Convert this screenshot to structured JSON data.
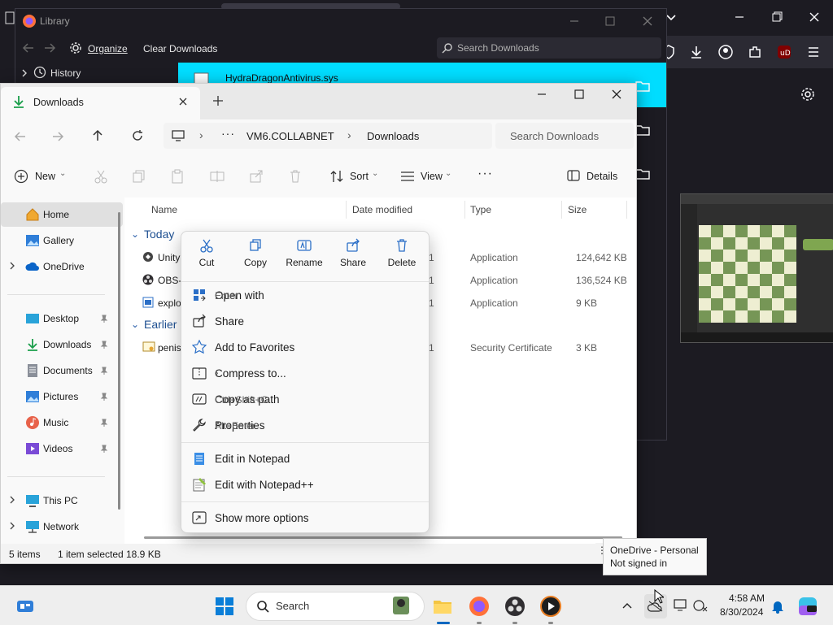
{
  "library": {
    "title": "Library",
    "organize_label": "Organize",
    "clear_label": "Clear Downloads",
    "search_placeholder": "Search Downloads",
    "history_label": "History",
    "file_name": "HydraDragonAntivirus.sys"
  },
  "explorer": {
    "tab_title": "Downloads",
    "breadcrumb": [
      "VM6.COLLABNET",
      "Downloads"
    ],
    "search_placeholder": "Search Downloads",
    "cmd": {
      "new": "New",
      "sort": "Sort",
      "view": "View",
      "details": "Details"
    },
    "sidebar": {
      "home": "Home",
      "gallery": "Gallery",
      "onedrive": "OneDrive",
      "desktop": "Desktop",
      "downloads": "Downloads",
      "documents": "Documents",
      "pictures": "Pictures",
      "music": "Music",
      "videos": "Videos",
      "thispc": "This PC",
      "network": "Network"
    },
    "columns": {
      "name": "Name",
      "date": "Date modified",
      "type": "Type",
      "size": "Size"
    },
    "groups": {
      "today": "Today",
      "earlier": "Earlier"
    },
    "files": [
      {
        "name": "Unity",
        "date": "1",
        "type": "Application",
        "size": "124,642 KB"
      },
      {
        "name": "OBS-",
        "date": "1",
        "type": "Application",
        "size": "136,524 KB"
      },
      {
        "name": "explo",
        "date": "1",
        "type": "Application",
        "size": "9 KB"
      },
      {
        "name": "penis",
        "date": "1",
        "type": "Security Certificate",
        "size": "3 KB"
      }
    ],
    "status": {
      "items": "5 items",
      "selected": "1 item selected",
      "size": "18.9 KB"
    }
  },
  "context_menu": {
    "top": {
      "cut": "Cut",
      "copy": "Copy",
      "rename": "Rename",
      "share": "Share",
      "delete": "Delete"
    },
    "items": [
      {
        "label": "Open with",
        "shortcut": "Enter"
      },
      {
        "label": "Share",
        "shortcut": ""
      },
      {
        "label": "Add to Favorites",
        "shortcut": ""
      },
      {
        "label": "Compress to...",
        "shortcut": ""
      },
      {
        "label": "Copy as path",
        "shortcut": "Ctrl+Shift+C"
      },
      {
        "label": "Properties",
        "shortcut": "Alt+Enter"
      },
      {
        "label": "Edit in Notepad",
        "shortcut": ""
      },
      {
        "label": "Edit with Notepad++",
        "shortcut": ""
      },
      {
        "label": "Show more options",
        "shortcut": ""
      }
    ]
  },
  "tooltip": {
    "line1": "OneDrive - Personal",
    "line2": "Not signed in"
  },
  "taskbar": {
    "search_label": "Search",
    "time": "4:58 AM",
    "date": "8/30/2024"
  },
  "colors": {
    "accent": "#0067c0",
    "library_highlight": "#00ddff",
    "folder": "#f4c542"
  }
}
